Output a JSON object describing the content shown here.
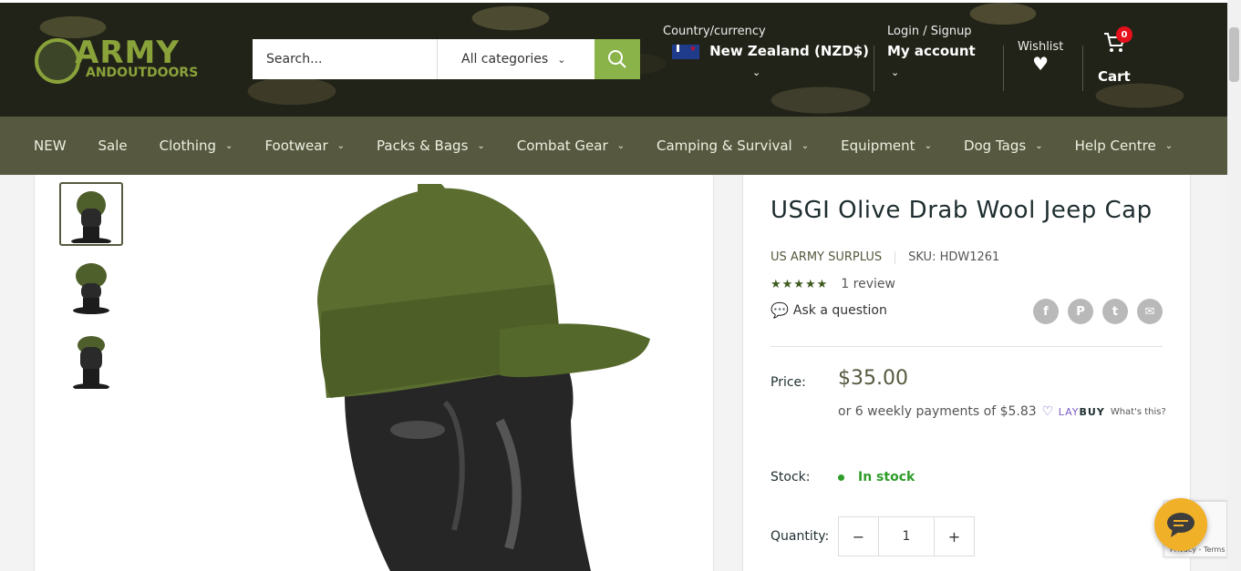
{
  "header": {
    "logo": {
      "line1": "ARMY",
      "line2": "ANDOUTDOORS"
    },
    "search": {
      "placeholder": "Search...",
      "category": "All categories"
    },
    "country": {
      "label": "Country/currency",
      "value": "New Zealand (NZD$)"
    },
    "account": {
      "label": "Login / Signup",
      "value": "My account"
    },
    "wishlist": {
      "label": "Wishlist"
    },
    "cart": {
      "label": "Cart",
      "count": "0"
    }
  },
  "nav": {
    "items": [
      {
        "label": "NEW",
        "dropdown": false
      },
      {
        "label": "Sale",
        "dropdown": false
      },
      {
        "label": "Clothing",
        "dropdown": true
      },
      {
        "label": "Footwear",
        "dropdown": true
      },
      {
        "label": "Packs & Bags",
        "dropdown": true
      },
      {
        "label": "Combat Gear",
        "dropdown": true
      },
      {
        "label": "Camping & Survival",
        "dropdown": true
      },
      {
        "label": "Equipment",
        "dropdown": true
      },
      {
        "label": "Dog Tags",
        "dropdown": true
      },
      {
        "label": "Help Centre",
        "dropdown": true
      }
    ]
  },
  "product": {
    "title": "USGI Olive Drab Wool Jeep Cap",
    "vendor": "US ARMY SURPLUS",
    "sku": "SKU: HDW1261",
    "stars": "★★★★★",
    "reviews": "1 review",
    "ask": "Ask a question",
    "share": [
      "f",
      "P",
      "t",
      "✉"
    ],
    "price_label": "Price:",
    "price": "$35.00",
    "laybuy_text": "or 6 weekly payments of $5.83",
    "laybuy_brand_a": "LAY",
    "laybuy_brand_b": "BUY",
    "laybuy_whats": "What's this?",
    "stock_label": "Stock:",
    "stock_value": "In stock",
    "quantity_label": "Quantity:",
    "quantity": "1",
    "minus": "−",
    "plus": "+"
  },
  "recaptcha": {
    "text": "Privacy - Terms"
  },
  "colors": {
    "brand": "#8ab34a",
    "nav_bg": "#56593f",
    "price": "#56593f",
    "stock": "#2e9c29",
    "badge": "#e5101b",
    "chat": "#f0b028"
  }
}
